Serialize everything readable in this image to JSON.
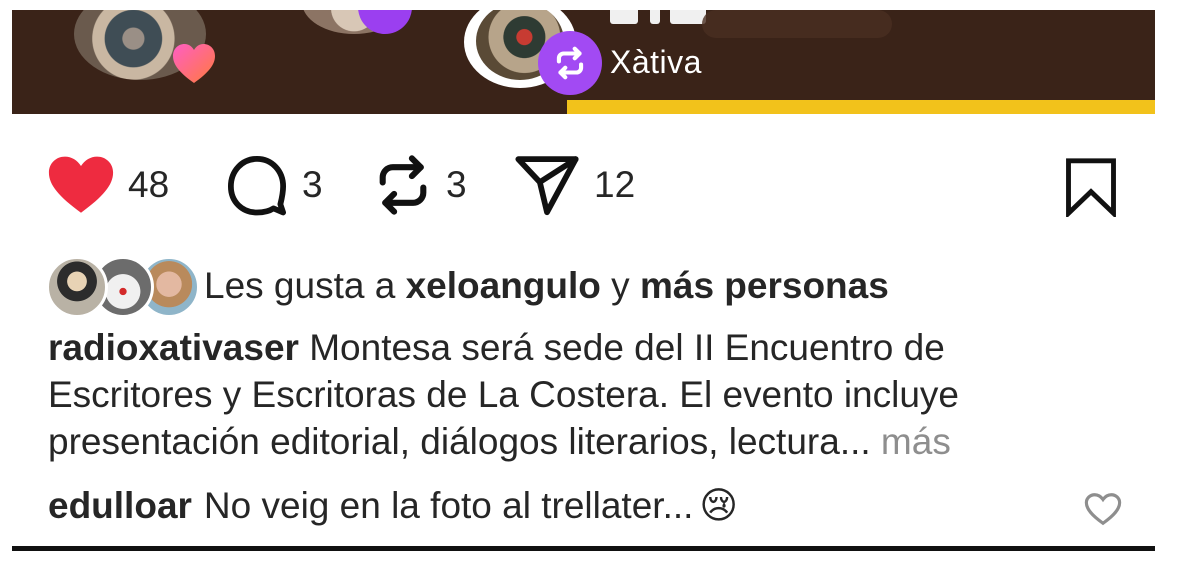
{
  "post": {
    "location_label": "Xàtiva",
    "image_colors": {
      "background": "#3a2318",
      "accent_bar": "#f2c21b",
      "repost_badge": "#a24af3"
    }
  },
  "actions": {
    "like": {
      "icon": "heart-icon",
      "count": "48",
      "color": "#ee2b40"
    },
    "comment": {
      "icon": "comment-bubble-icon",
      "count": "3"
    },
    "repost": {
      "icon": "repost-icon",
      "count": "3"
    },
    "share": {
      "icon": "send-icon",
      "count": "12"
    },
    "save": {
      "icon": "bookmark-icon"
    }
  },
  "liked_by": {
    "prefix": "Les gusta a ",
    "user": "xeloangulo",
    "middle": " y ",
    "others": "más personas"
  },
  "caption": {
    "username": "radioxativaser",
    "text": " Montesa será sede del II Encuentro de Escritores y Escritoras de La Costera. El evento incluye presentación editorial, diálogos literarios, lectura...",
    "more_label": " más"
  },
  "comment": {
    "username": "edulloar",
    "text": "No veig en la foto al trellater...",
    "emoji": "😢"
  }
}
